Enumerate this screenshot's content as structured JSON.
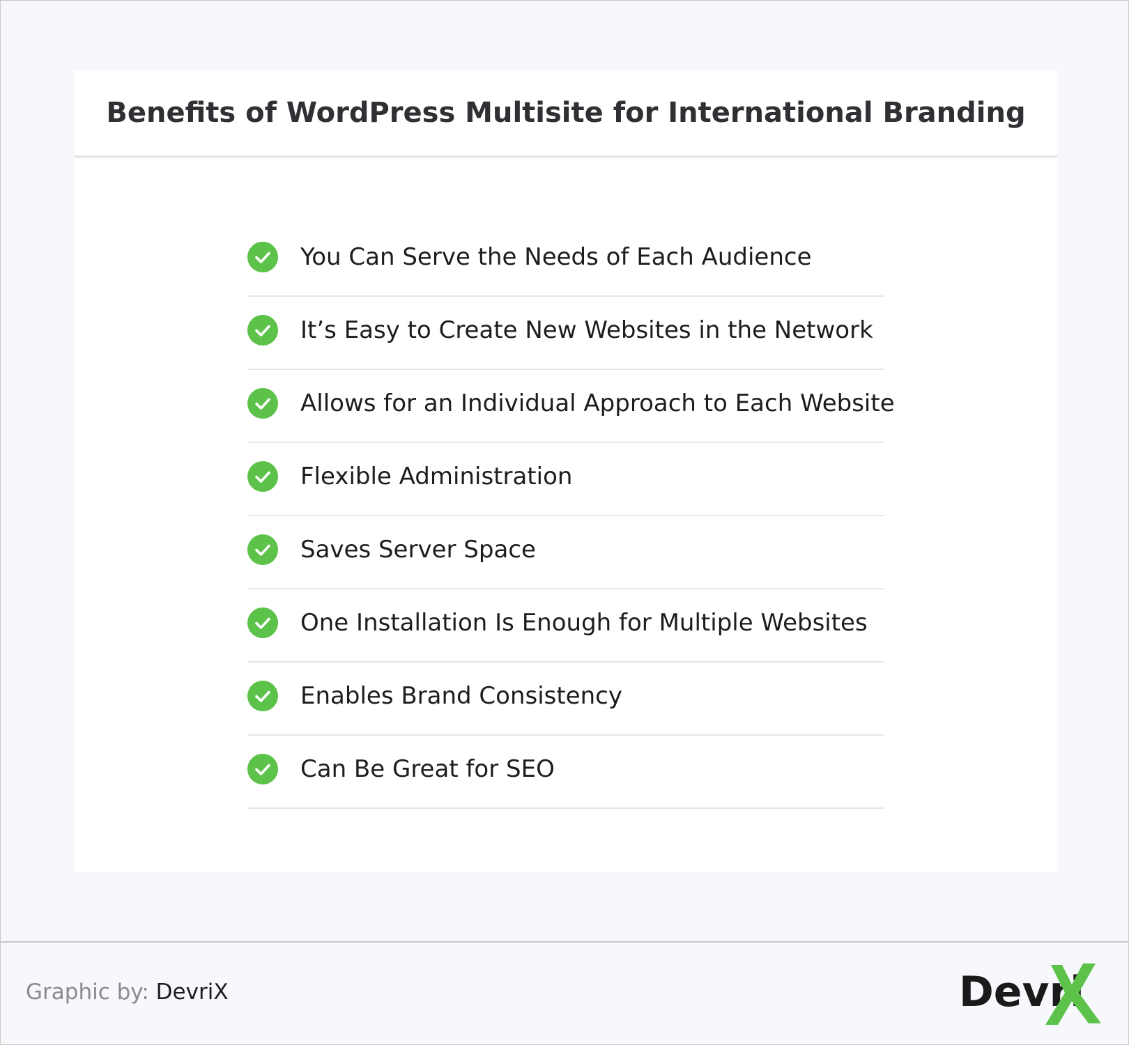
{
  "title": "Benefits of WordPress Multisite for International Branding",
  "items": [
    "You Can Serve the Needs of Each Audience",
    "It’s Easy to Create New Websites in the Network",
    "Allows for an Individual Approach to Each Website",
    "Flexible Administration",
    "Saves Server Space",
    "One Installation Is Enough for Multiple Websites",
    "Enables Brand Consistency",
    "Can Be Great for SEO"
  ],
  "item_icon": "check-circle-icon",
  "footer": {
    "credit_prefix": "Graphic by:",
    "credit_name": "DevriX",
    "logo_text": "Devri"
  },
  "colors": {
    "accent_green": "#5cc249",
    "logo_green": "#5cc249",
    "background": "#f7f8fb"
  }
}
